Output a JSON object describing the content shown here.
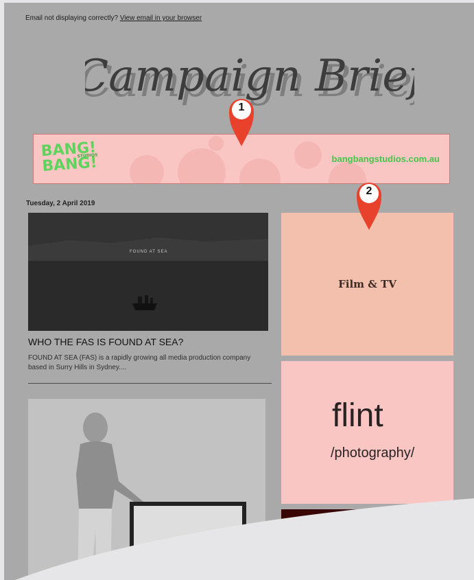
{
  "header": {
    "notice_text": "Email not displaying correctly?",
    "notice_link": "View email in your browser",
    "logo_text": "Campaign Brief"
  },
  "banner": {
    "logo_line1": "BANG!",
    "logo_line2": "BANG!",
    "logo_small": "STUDIOS",
    "url": "bangbangstudios.com.au"
  },
  "date": "Tuesday, 2 April 2019",
  "article": {
    "image_caption": "FOUND AT SEA",
    "title": "WHO THE FAS IS FOUND AT SEA?",
    "description": "FOUND AT SEA (FAS) is a rapidly growing all media production company based in Surry Hills in Sydney...."
  },
  "tiles": {
    "film": "Film & TV",
    "flint_word": "flint",
    "flint_sub": "/photography/"
  },
  "markers": [
    "1",
    "2"
  ],
  "colors": {
    "email_background": "#a9a9a9",
    "banner_pink": "#f9c6c4",
    "banner_green": "#5ed35d",
    "film_tile": "#f3c0ad",
    "marker_red": "#e8412c"
  }
}
